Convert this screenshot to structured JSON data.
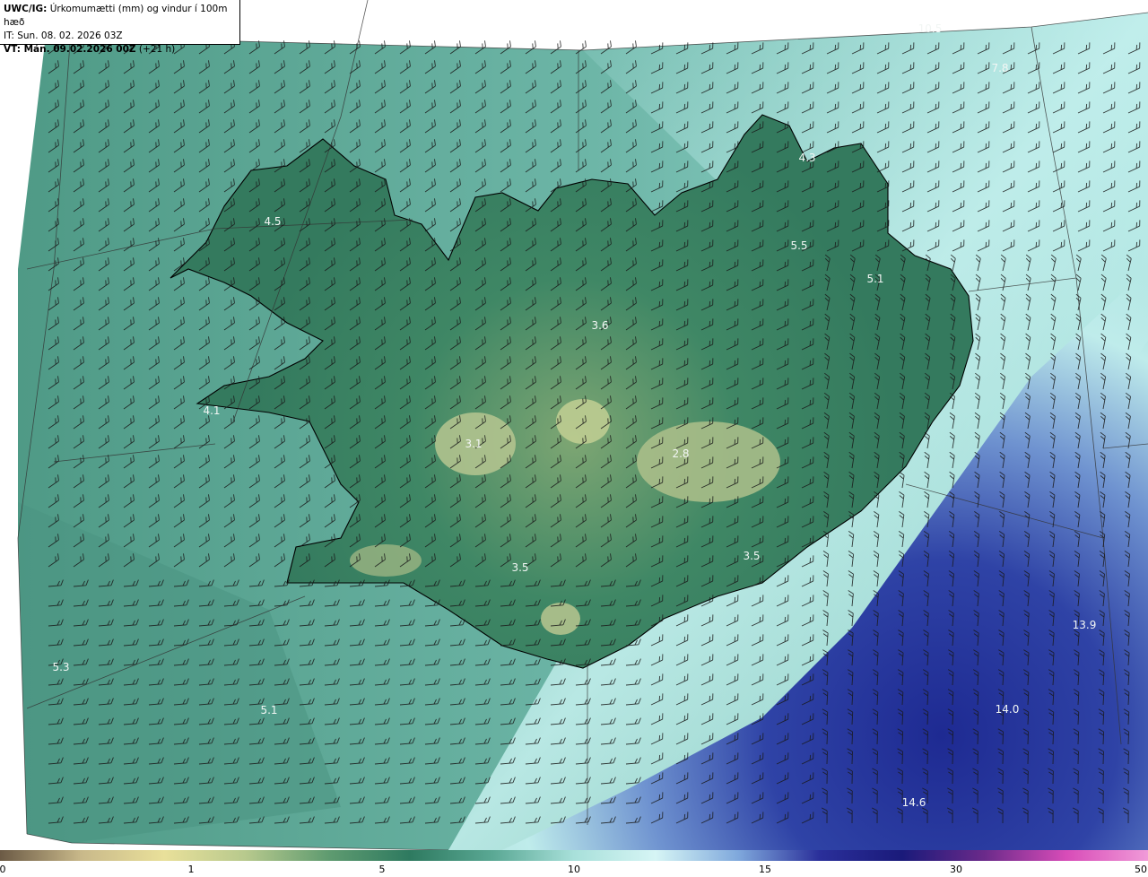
{
  "header": {
    "line1_bold": "UWC/IG:",
    "line1_rest": " Úrkomumætti (mm) og vindur í 100m hæð",
    "line2": "IT: Sun. 08. 02. 2026 03Z",
    "line3_bold": "VT: Mán. 09.02.2026 00Z",
    "line3_rest": " (+21 h)"
  },
  "map_values": [
    {
      "value": "10.5",
      "color": "#a8d8d4"
    },
    {
      "value": "7.8",
      "color": "#a8d8d4"
    },
    {
      "value": "4.3",
      "color": "#c0e6e2"
    },
    {
      "value": "4.5",
      "color": "#d4ecdc"
    },
    {
      "value": "5.5",
      "color": "#d4ecdc"
    },
    {
      "value": "5.1",
      "color": "#d4ecdc"
    },
    {
      "value": "3.6",
      "color": "#e8f0dc"
    },
    {
      "value": "4.1",
      "color": "#e4eee0"
    },
    {
      "value": "3.1",
      "color": "#e8f0dc"
    },
    {
      "value": "2.8",
      "color": "#e8f0dc"
    },
    {
      "value": "3.5",
      "color": "#e8f0dc"
    },
    {
      "value": "3.5",
      "color": "#e8f0dc"
    },
    {
      "value": "5.3",
      "color": "#e0ece4"
    },
    {
      "value": "5.1",
      "color": "#e0ece4"
    },
    {
      "value": "13.9",
      "color": "#dde0f4"
    },
    {
      "value": "14.0",
      "color": "#dde0f4"
    },
    {
      "value": "14.6",
      "color": "#dde0f4"
    }
  ],
  "legend": {
    "ticks": [
      {
        "label": "0",
        "value": 0
      },
      {
        "label": "1",
        "value": 1
      },
      {
        "label": "5",
        "value": 5
      },
      {
        "label": "10",
        "value": 10
      },
      {
        "label": "15",
        "value": 15
      },
      {
        "label": "30",
        "value": 30
      },
      {
        "label": "50",
        "value": 50
      }
    ],
    "colors": [
      "#6b5a45",
      "#c9b98a",
      "#e9e09a",
      "#b7c98d",
      "#5f9b70",
      "#2e7a60",
      "#5aa894",
      "#a8e0da",
      "#d6f5f5",
      "#7fa8dc",
      "#2a2f9a",
      "#1a1a7a",
      "#6a2a8a",
      "#d84cb8",
      "#f09ad8"
    ]
  },
  "colors": {
    "ocean_low": "#5fa89a",
    "ocean_mid": "#a5e2de",
    "ocean_high": "#2d3c9c",
    "land_low": "#3f8a66",
    "land_high": "#bcc98f",
    "coast": "#000000"
  }
}
